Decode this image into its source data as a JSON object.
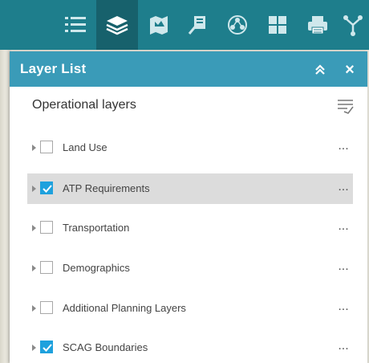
{
  "toolbar": {
    "buttons": [
      {
        "icon": "list-icon"
      },
      {
        "icon": "layers-icon",
        "active": true
      },
      {
        "icon": "legend-map-icon"
      },
      {
        "icon": "draw-icon"
      },
      {
        "icon": "analysis-icon"
      },
      {
        "icon": "basemap-gallery-icon"
      },
      {
        "icon": "print-icon"
      },
      {
        "icon": "share-icon"
      }
    ],
    "color": "#1e7e8c"
  },
  "panel": {
    "title": "Layer List",
    "header_color": "#3a9bb8",
    "close_label": "×",
    "section_title": "Operational layers",
    "layers": [
      {
        "label": "Land Use",
        "checked": false,
        "selected": false,
        "more": "..."
      },
      {
        "label": "ATP Requirements",
        "checked": true,
        "selected": true,
        "more": "..."
      },
      {
        "label": "Transportation",
        "checked": false,
        "selected": false,
        "more": "..."
      },
      {
        "label": "Demographics",
        "checked": false,
        "selected": false,
        "more": "..."
      },
      {
        "label": "Additional Planning Layers",
        "checked": false,
        "selected": false,
        "more": "..."
      },
      {
        "label": "SCAG Boundaries",
        "checked": true,
        "selected": false,
        "more": "..."
      }
    ]
  },
  "colors": {
    "checkbox_checked": "#1ea1dd",
    "selected_row": "#dcdcdc"
  }
}
